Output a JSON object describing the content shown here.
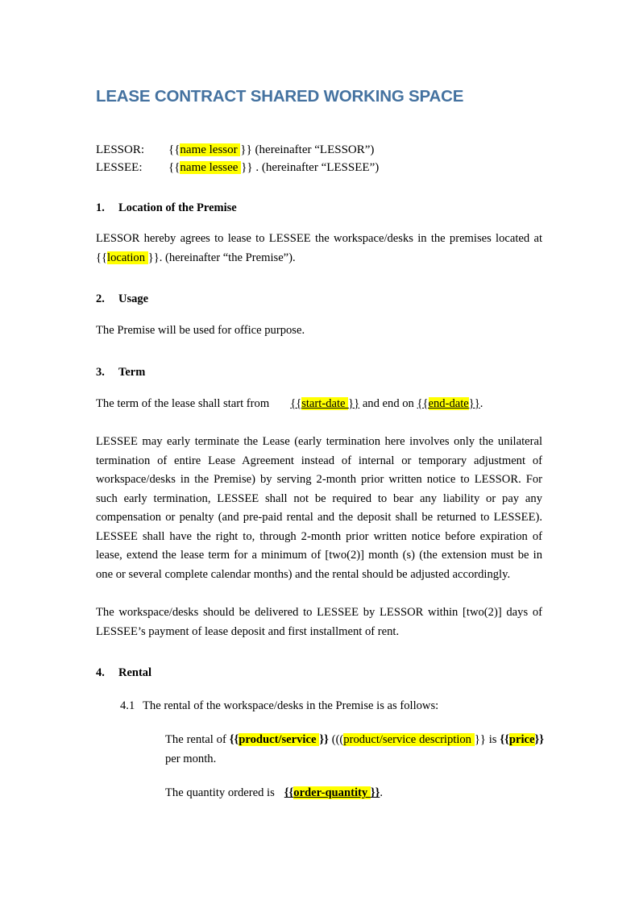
{
  "document": {
    "title": "LEASE CONTRACT SHARED WORKING SPACE",
    "title_color": "#4472A0",
    "highlight_color": "#FFFF00",
    "parties": {
      "lessor": {
        "label": "LESSOR:",
        "open_brace": "{{",
        "placeholder": "name lessor ",
        "close_brace": "}}",
        "suffix": " (hereinafter “LESSOR”)"
      },
      "lessee": {
        "label": "LESSEE:",
        "open_brace": "{{",
        "placeholder": "name lessee ",
        "close_brace": "}}",
        "suffix": " . (hereinafter “LESSEE”)"
      }
    },
    "sections": [
      {
        "number": "1.",
        "heading": "Location of the Premise",
        "paragraph_before": "LESSOR hereby agrees to lease to LESSEE the workspace/desks in the premises located at ",
        "open_brace": "{{",
        "placeholder": "location ",
        "close_brace": "}}",
        "paragraph_after": ". (hereinafter “the Premise”)."
      },
      {
        "number": "2.",
        "heading": "Usage",
        "paragraph": "The Premise will be used for office purpose."
      },
      {
        "number": "3.",
        "heading": "Term",
        "term_line": {
          "prefix": "The term of the lease shall start from",
          "start_open": "{{",
          "start_placeholder": "start-date ",
          "start_close": "}}",
          "middle": " and end on ",
          "end_open": "{{",
          "end_placeholder": "end-date",
          "end_close": "}}",
          "suffix": "."
        },
        "paragraph_2": "LESSEE may early terminate the Lease (early termination here involves only the unilateral termination of entire Lease Agreement instead of internal or temporary adjustment of workspace/desks in the Premise) by serving 2-month prior written notice to LESSOR. For such early termination, LESSEE shall not be required to bear any liability or pay any compensation or penalty (and pre-paid rental and the deposit shall be returned to LESSEE). LESSEE shall have the right to, through 2-month prior written notice before expiration of lease, extend the lease term for a minimum of [two(2)] month (s) (the extension must be in one or several complete calendar months) and the rental should be adjusted accordingly.",
        "paragraph_3": "The workspace/desks should be delivered to LESSEE by LESSOR within [two(2)] days of LESSEE’s payment of lease deposit and first installment of rent."
      },
      {
        "number": "4.",
        "heading": "Rental",
        "clause_4_1": {
          "number": "4.1",
          "text": "The rental of the workspace/desks in the Premise is as follows:"
        },
        "rental_line": {
          "prefix": "The rental of ",
          "product_open": "{{",
          "product_placeholder": "product/service ",
          "product_close": "}}",
          "desc_prefix": " (((",
          "desc_placeholder": "product/service   description ",
          "desc_close": "}}",
          "desc_suffix": " is ",
          "price_open": "{{",
          "price_placeholder": "price",
          "price_close": "}}",
          "price_suffix": " per month."
        },
        "quantity_line": {
          "prefix": "The quantity ordered is",
          "open_brace": "{{",
          "placeholder": "order-quantity ",
          "close_brace": "}}",
          "suffix": "."
        }
      }
    ]
  }
}
